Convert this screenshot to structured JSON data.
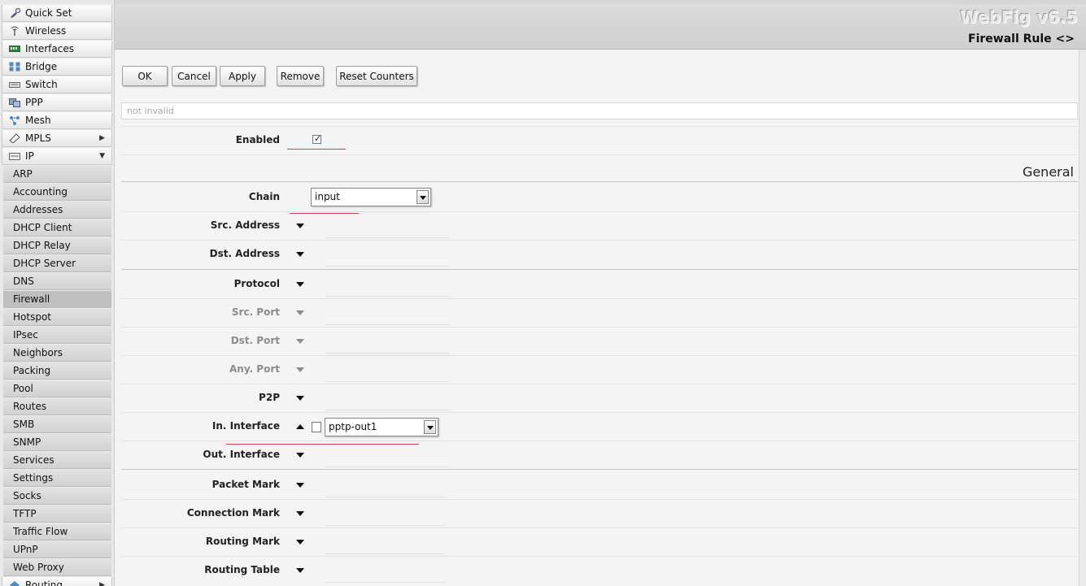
{
  "sidebar": {
    "items": [
      {
        "label": "Quick Set",
        "icon": "quick-set-icon"
      },
      {
        "label": "Wireless",
        "icon": "wireless-icon"
      },
      {
        "label": "Interfaces",
        "icon": "interfaces-icon"
      },
      {
        "label": "Bridge",
        "icon": "bridge-icon"
      },
      {
        "label": "Switch",
        "icon": "switch-icon"
      },
      {
        "label": "PPP",
        "icon": "ppp-icon"
      },
      {
        "label": "Mesh",
        "icon": "mesh-icon"
      },
      {
        "label": "MPLS",
        "icon": "mpls-icon",
        "arrow": "▶"
      },
      {
        "label": "IP",
        "icon": "ip-icon",
        "arrow": "▼"
      }
    ],
    "ip_subitems": [
      "ARP",
      "Accounting",
      "Addresses",
      "DHCP Client",
      "DHCP Relay",
      "DHCP Server",
      "DNS",
      "Firewall",
      "Hotspot",
      "IPsec",
      "Neighbors",
      "Packing",
      "Pool",
      "Routes",
      "SMB",
      "SNMP",
      "Services",
      "Settings",
      "Socks",
      "TFTP",
      "Traffic Flow",
      "UPnP",
      "Web Proxy"
    ],
    "active_subitem": "Firewall",
    "cutoff_item": {
      "label": "Routing",
      "arrow": "▶"
    }
  },
  "header": {
    "brand": "WebFig v6.5",
    "title": "Firewall Rule <>"
  },
  "toolbar": {
    "ok_label": "OK",
    "cancel_label": "Cancel",
    "apply_label": "Apply",
    "remove_label": "Remove",
    "reset_counters_label": "Reset Counters"
  },
  "status": {
    "text": "not invalid"
  },
  "form": {
    "enabled_label": "Enabled",
    "enabled_checked": true,
    "section_general": "General",
    "chain_label": "Chain",
    "chain_value": "input",
    "src_address_label": "Src. Address",
    "dst_address_label": "Dst. Address",
    "protocol_label": "Protocol",
    "src_port_label": "Src. Port",
    "dst_port_label": "Dst. Port",
    "any_port_label": "Any. Port",
    "p2p_label": "P2P",
    "in_interface_label": "In. Interface",
    "in_interface_value": "pptp-out1",
    "in_interface_negate": false,
    "out_interface_label": "Out. Interface",
    "packet_mark_label": "Packet Mark",
    "connection_mark_label": "Connection Mark",
    "routing_mark_label": "Routing Mark",
    "routing_table_label": "Routing Table"
  },
  "colors": {
    "annotation_underline": "#cc4444",
    "header_bg": "#d4d4d4"
  }
}
